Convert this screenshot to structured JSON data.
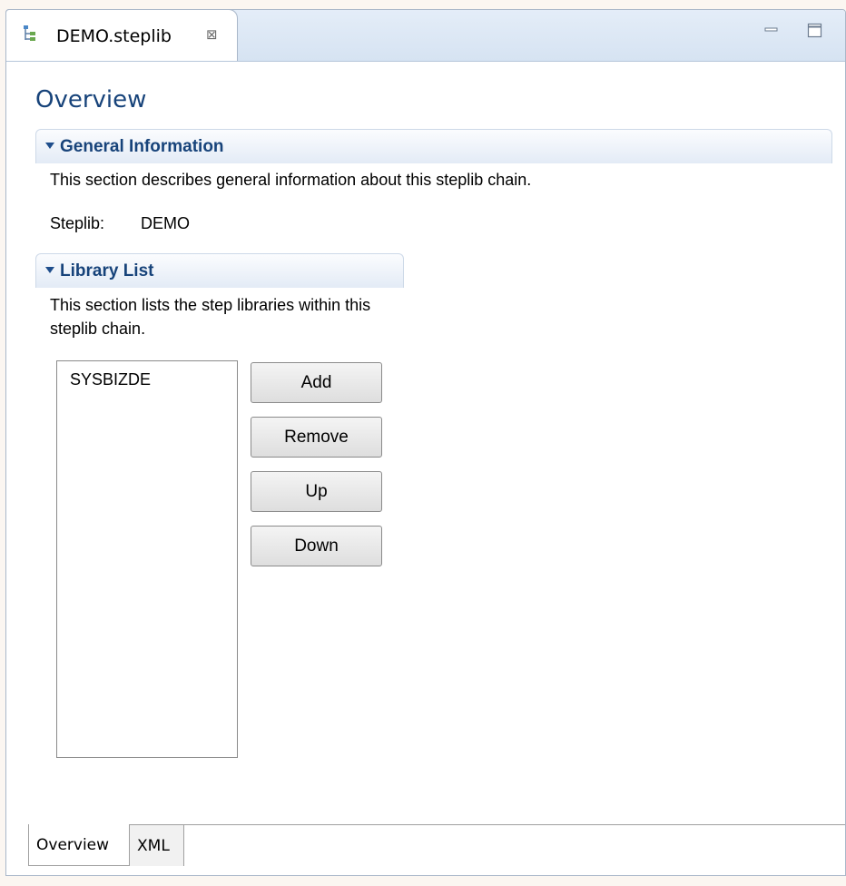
{
  "editor": {
    "tab_title": "DEMO.steplib",
    "tab_icon": "steplib-tree-icon",
    "close_icon": "close-icon",
    "minimize_icon": "minimize-icon",
    "maximize_icon": "maximize-icon"
  },
  "page": {
    "title": "Overview"
  },
  "general_section": {
    "title": "General Information",
    "description": "This section describes general information about this steplib chain.",
    "steplib_label": "Steplib:",
    "steplib_value": "DEMO"
  },
  "library_section": {
    "title": "Library List",
    "description": "This section lists the step libraries within this steplib chain.",
    "items": [
      "SYSBIZDE"
    ],
    "buttons": {
      "add": "Add",
      "remove": "Remove",
      "up": "Up",
      "down": "Down"
    }
  },
  "bottom_tabs": {
    "overview": "Overview",
    "xml": "XML",
    "selected": "Overview"
  },
  "colors": {
    "section_title": "#17437a",
    "header_gradient_top": "#fbfcfe",
    "header_gradient_bottom": "#e3ebf6",
    "tab_strip": "#d6e3f2"
  }
}
